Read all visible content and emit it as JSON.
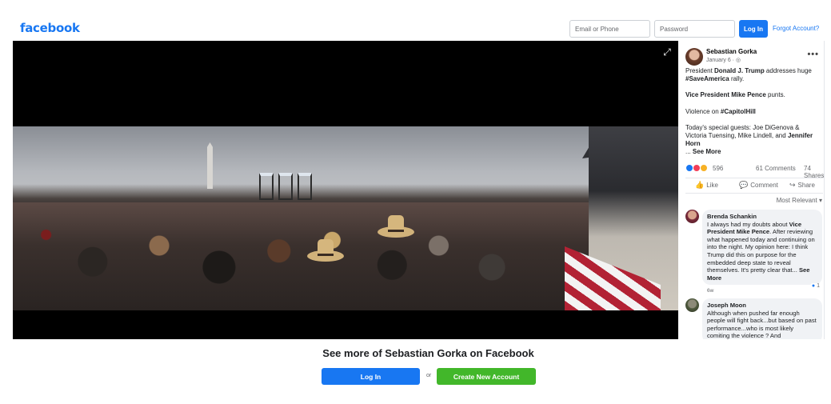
{
  "header": {
    "logo": "facebook",
    "email_placeholder": "Email or Phone",
    "password_placeholder": "Password",
    "login_label": "Log In",
    "forgot_label": "Forgot Account?"
  },
  "video": {
    "expand_glyph": "⤢"
  },
  "post": {
    "author": "Sebastian Gorka",
    "date": "January 6 · ◎",
    "more": "•••",
    "line1_pre": "President ",
    "line1_bold": "Donald J. Trump",
    "line1_post": " addresses huge",
    "line2_bold": "#SaveAmerica",
    "line2_post": " rally.",
    "para2_bold": "Vice President Mike Pence",
    "para2_post": " punts.",
    "para3_pre": "Violence on ",
    "para3_bold": "#CapitolHill",
    "para4": "Today's special guests: Joe DiGenova & Victoria Tuensing, Mike Lindell, and ",
    "para4_bold": "Jennifer Horn",
    "ellipsis": "... ",
    "see_more": "See More",
    "reaction_count": "596",
    "comments_count": "61 Comments",
    "shares_count": "74 Shares",
    "like_label": "Like",
    "comment_label": "Comment",
    "share_label": "Share",
    "sort_label": "Most Relevant ▾"
  },
  "comments": [
    {
      "name": "Brenda Schankin",
      "text_pre": "I always had my doubts about ",
      "text_bold": "Vice President Mike Pence",
      "text_post": ". After reviewing what happened today and continuing on into the night. My opinion here: I think Trump did this on purpose for the embedded deep state to reveal themselves. It's pretty clear that... ",
      "see_more": "See More",
      "reactions": "1",
      "meta": "6w"
    },
    {
      "name": "Joseph Moon",
      "text": "Although when pushed far enough people will fight back...but based on past performance...who is most likely comiting the violence ? And"
    }
  ],
  "cta": {
    "title": "See more of Sebastian Gorka on Facebook",
    "login_label": "Log In",
    "or_label": "or",
    "create_label": "Create New Account"
  },
  "colors": {
    "brand_blue": "#1877f2",
    "create_green": "#42b72a"
  }
}
